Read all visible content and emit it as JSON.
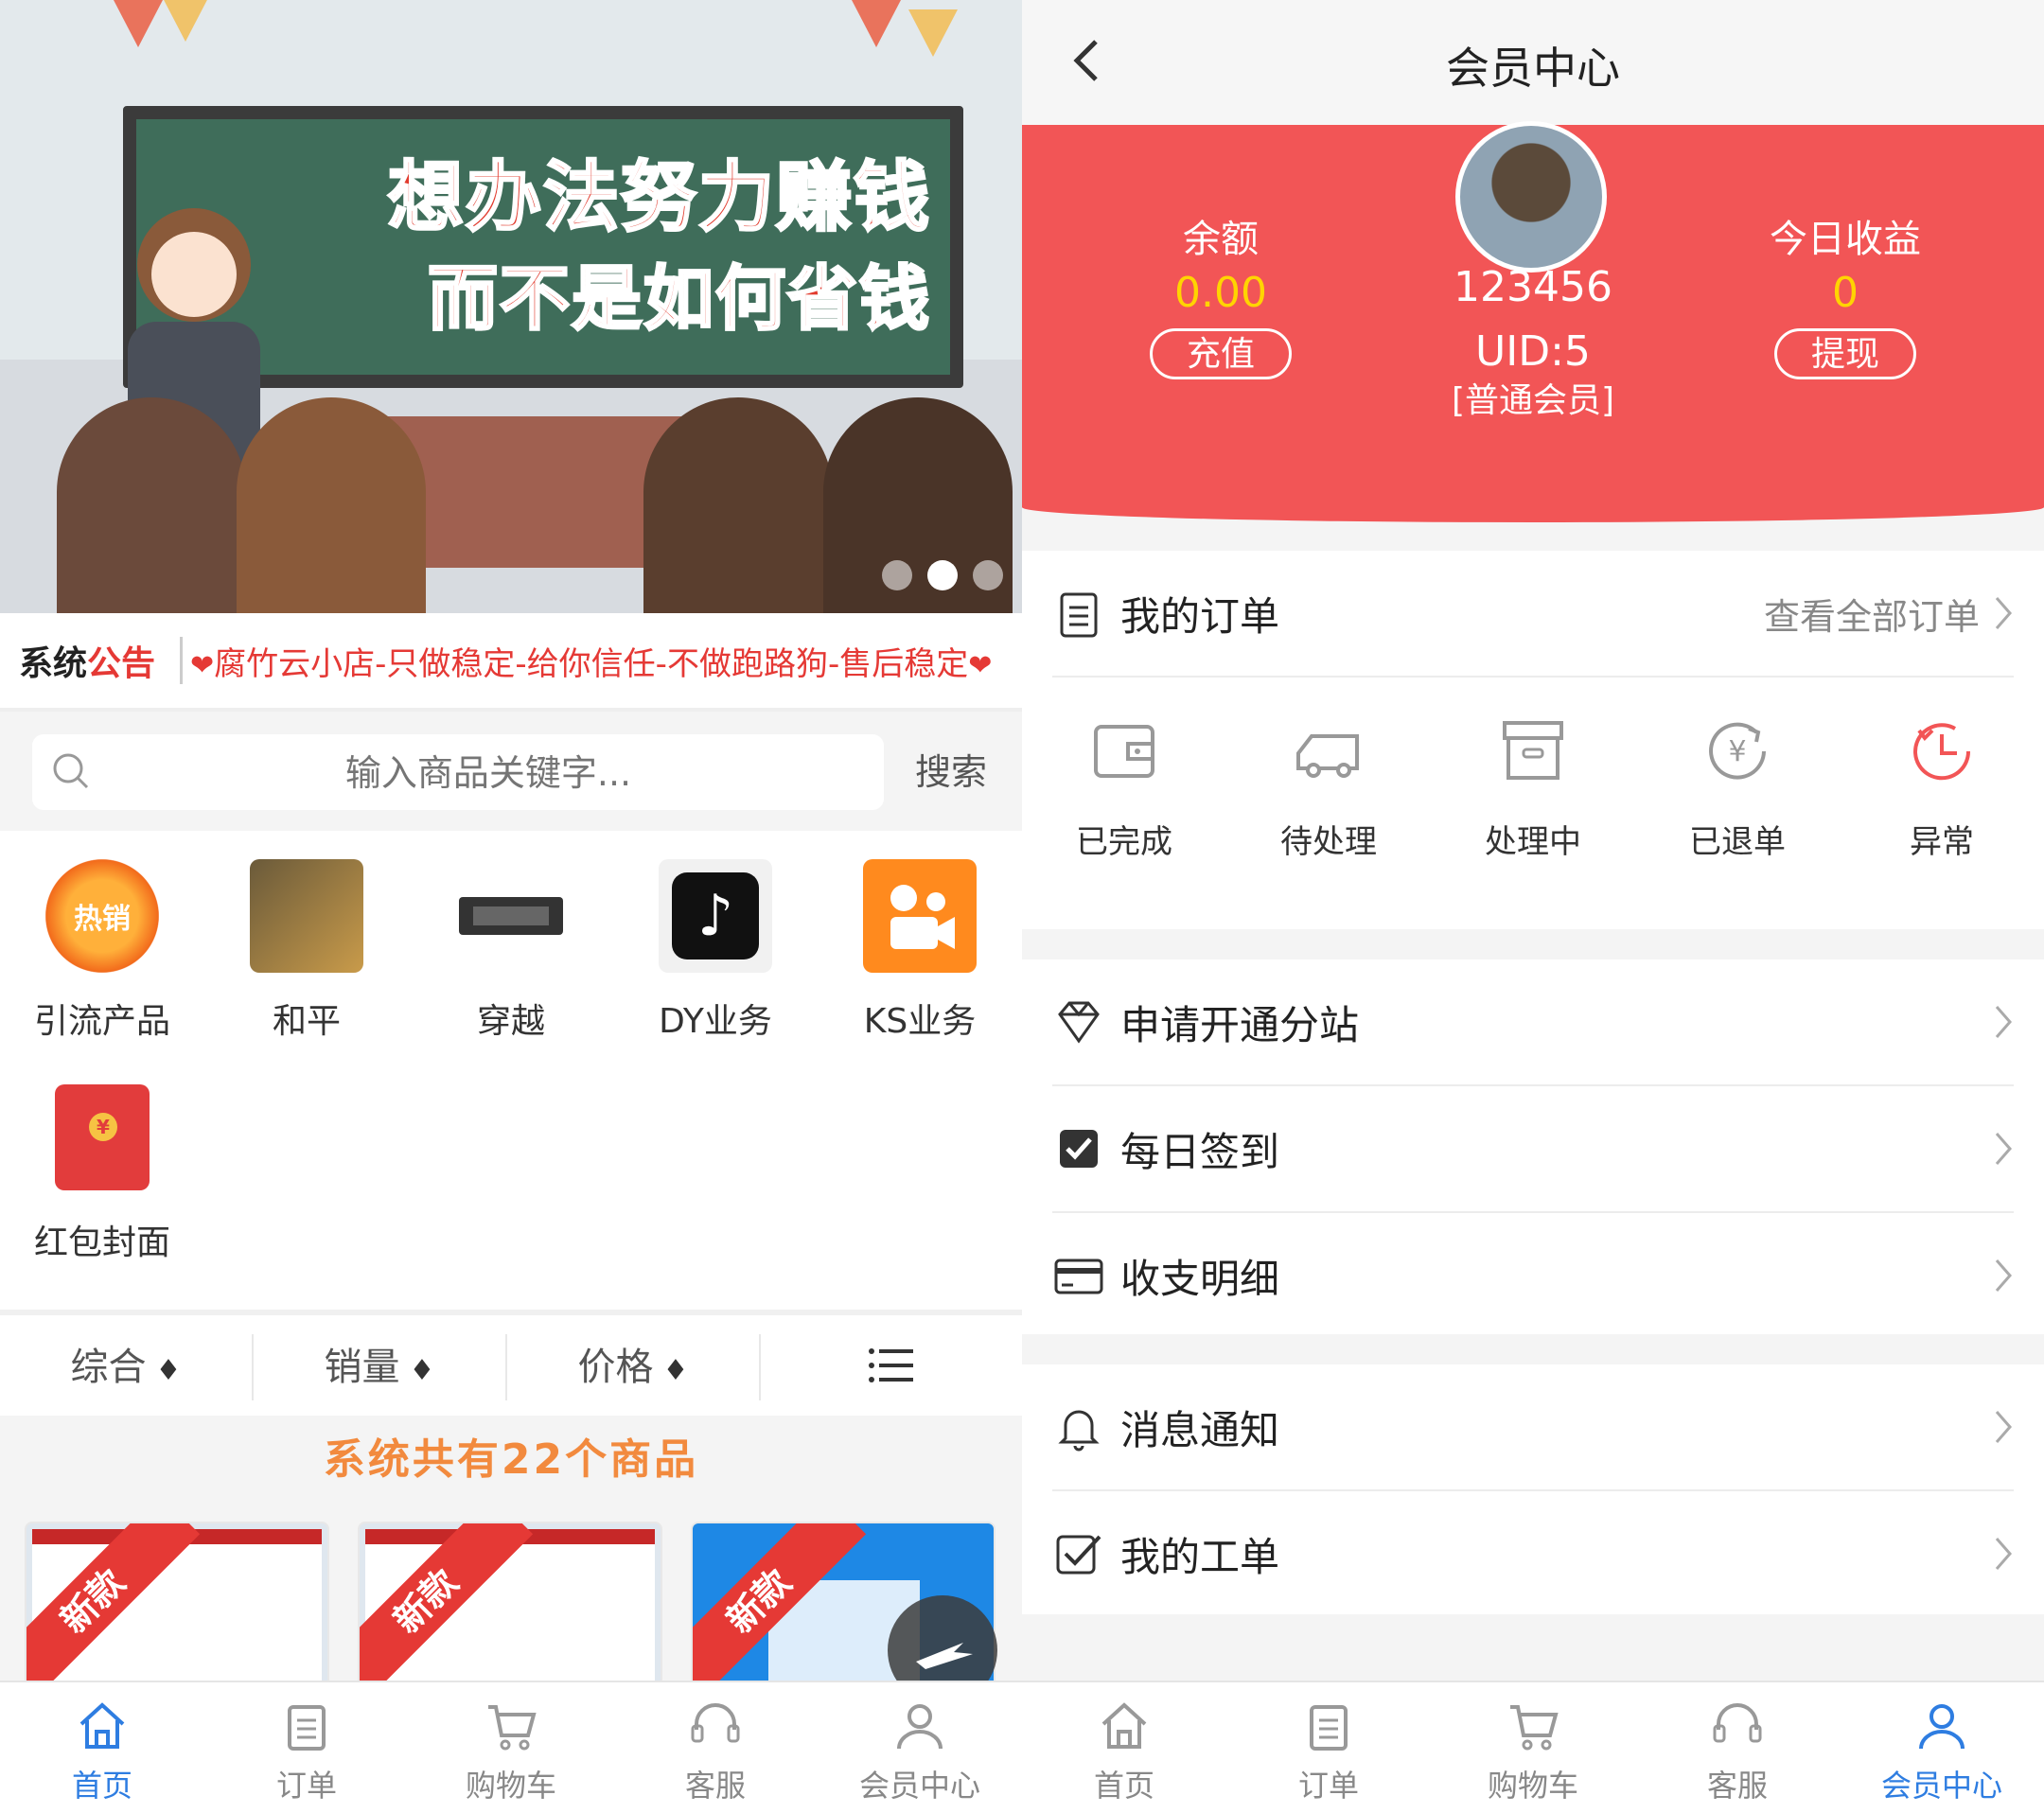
{
  "left": {
    "banner": {
      "line1": "想办法努力赚钱",
      "line2": "而不是如何省钱"
    },
    "notice": {
      "tag_black": "系统",
      "tag_red": "公告",
      "text": "腐竹云小店-只做稳定-给你信任-不做跑路狗-售后稳定"
    },
    "search": {
      "placeholder": "输入商品关键字...",
      "button": "搜索"
    },
    "categories": [
      {
        "label": "引流产品",
        "icon": "hot-sale-icon",
        "badge": "热销"
      },
      {
        "label": "和平",
        "icon": "game-peace-icon"
      },
      {
        "label": "穿越",
        "icon": "game-crossfire-icon"
      },
      {
        "label": "DY业务",
        "icon": "douyin-icon"
      },
      {
        "label": "KS业务",
        "icon": "kuaishou-icon"
      },
      {
        "label": "红包封面",
        "icon": "red-envelope-icon"
      }
    ],
    "sort": {
      "items": [
        "综合",
        "销量",
        "价格"
      ],
      "arrow": "♦"
    },
    "total_text": "系统共有22个商品",
    "product_badge": "新款",
    "tabs": [
      {
        "label": "首页",
        "icon": "home-icon",
        "active": true
      },
      {
        "label": "订单",
        "icon": "order-icon",
        "active": false
      },
      {
        "label": "购物车",
        "icon": "cart-icon",
        "active": false
      },
      {
        "label": "客服",
        "icon": "headset-icon",
        "active": false
      },
      {
        "label": "会员中心",
        "icon": "user-icon",
        "active": false
      }
    ]
  },
  "right": {
    "title": "会员中心",
    "balance": {
      "label": "余额",
      "value": "0.00",
      "button": "充值"
    },
    "earnings": {
      "label": "今日收益",
      "value": "0",
      "button": "提现"
    },
    "user": {
      "name": "123456",
      "uid": "UID:5",
      "level": "[普通会员]"
    },
    "orders": {
      "title": "我的订单",
      "view_all": "查看全部订单",
      "statuses": [
        {
          "label": "已完成",
          "icon": "wallet-icon"
        },
        {
          "label": "待处理",
          "icon": "truck-icon"
        },
        {
          "label": "处理中",
          "icon": "box-icon"
        },
        {
          "label": "已退单",
          "icon": "refund-icon"
        },
        {
          "label": "异常",
          "icon": "clock-alert-icon"
        }
      ]
    },
    "menu1": [
      {
        "label": "申请开通分站",
        "icon": "diamond-icon"
      },
      {
        "label": "每日签到",
        "icon": "checkbox-icon"
      },
      {
        "label": "收支明细",
        "icon": "card-icon"
      }
    ],
    "menu2": [
      {
        "label": "消息通知",
        "icon": "bell-icon"
      },
      {
        "label": "我的工单",
        "icon": "ticket-check-icon"
      }
    ],
    "tabs": [
      {
        "label": "首页",
        "icon": "home-icon",
        "active": false
      },
      {
        "label": "订单",
        "icon": "order-icon",
        "active": false
      },
      {
        "label": "购物车",
        "icon": "cart-icon",
        "active": false
      },
      {
        "label": "客服",
        "icon": "headset-icon",
        "active": false
      },
      {
        "label": "会员中心",
        "icon": "user-icon",
        "active": true
      }
    ]
  },
  "colors": {
    "accent_blue": "#2e7de1",
    "hero_red": "#f25556",
    "notice_red": "#e53935",
    "gold": "#ffd400",
    "total_orange": "#f28a3e"
  }
}
